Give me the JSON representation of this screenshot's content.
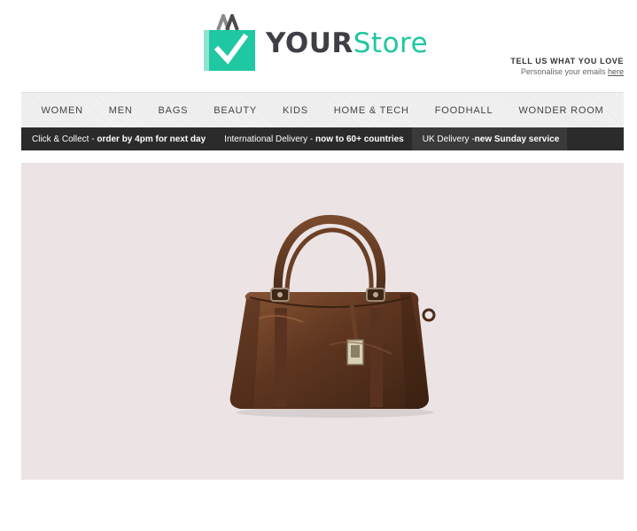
{
  "logo": {
    "word_your": "YOUR",
    "word_store": "Store",
    "icon": "shopping-bag-check-icon"
  },
  "tell_us": {
    "title": "TELL US WHAT YOU LOVE",
    "subtitle": "Personalise your emails",
    "link": "here"
  },
  "nav": {
    "items": [
      "WOMEN",
      "MEN",
      "BAGS",
      "BEAUTY",
      "KIDS",
      "HOME & TECH",
      "FOODHALL",
      "WONDER ROOM"
    ]
  },
  "promo": {
    "items": [
      {
        "lead": "Click & Collect - ",
        "bold": "order by 4pm for next day"
      },
      {
        "lead": "International Delivery - ",
        "bold": "now to 60+ countries"
      },
      {
        "lead": "UK Delivery - ",
        "bold": "new Sunday service"
      }
    ]
  },
  "hero": {
    "image": "brown-leather-handbag"
  },
  "colors": {
    "accent": "#1fc7a2",
    "dark": "#2b2b2b",
    "hero_bg": "#ebe3e4"
  }
}
